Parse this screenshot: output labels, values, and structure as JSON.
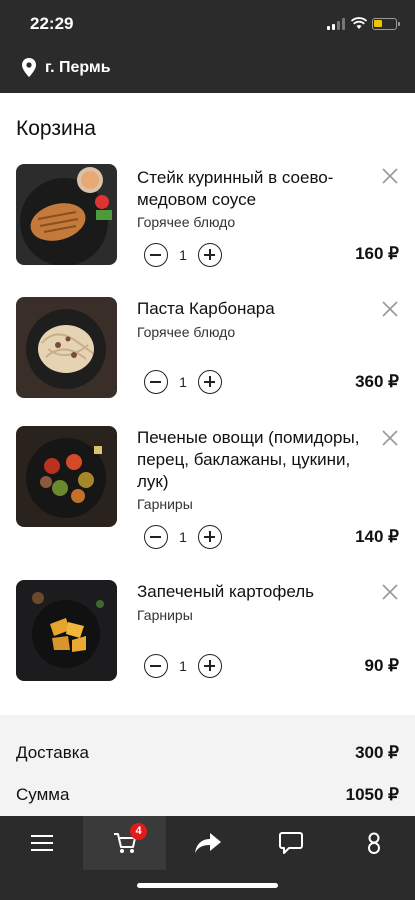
{
  "status_bar": {
    "time": "22:29"
  },
  "header": {
    "location": "г. Пермь"
  },
  "cart": {
    "title": "Корзина",
    "items": [
      {
        "name": "Стейк куринный в соево-медовом соусе",
        "category": "Горячее блюдо",
        "quantity": "1",
        "price": "160 ₽",
        "image": "chicken-steak"
      },
      {
        "name": "Паста Карбонара",
        "category": "Горячее блюдо",
        "quantity": "1",
        "price": "360 ₽",
        "image": "pasta"
      },
      {
        "name": "Печеные овощи (помидоры, перец, баклажаны, цукини, лук)",
        "category": "Гарниры",
        "quantity": "1",
        "price": "140 ₽",
        "image": "baked-vegetables"
      },
      {
        "name": "Запеченый картофель",
        "category": "Гарниры",
        "quantity": "1",
        "price": "90 ₽",
        "image": "baked-potatoes"
      }
    ]
  },
  "totals": {
    "delivery_label": "Доставка",
    "delivery_value": "300 ₽",
    "sum_label": "Сумма",
    "sum_value": "1050 ₽"
  },
  "nav": {
    "cart_badge": "4",
    "items": [
      "menu-icon",
      "cart-icon",
      "share-icon",
      "chat-icon",
      "profile-icon"
    ]
  },
  "colors": {
    "dark": "#2b2b2b",
    "badge": "#e01b1b",
    "battery": "#f2c500"
  }
}
